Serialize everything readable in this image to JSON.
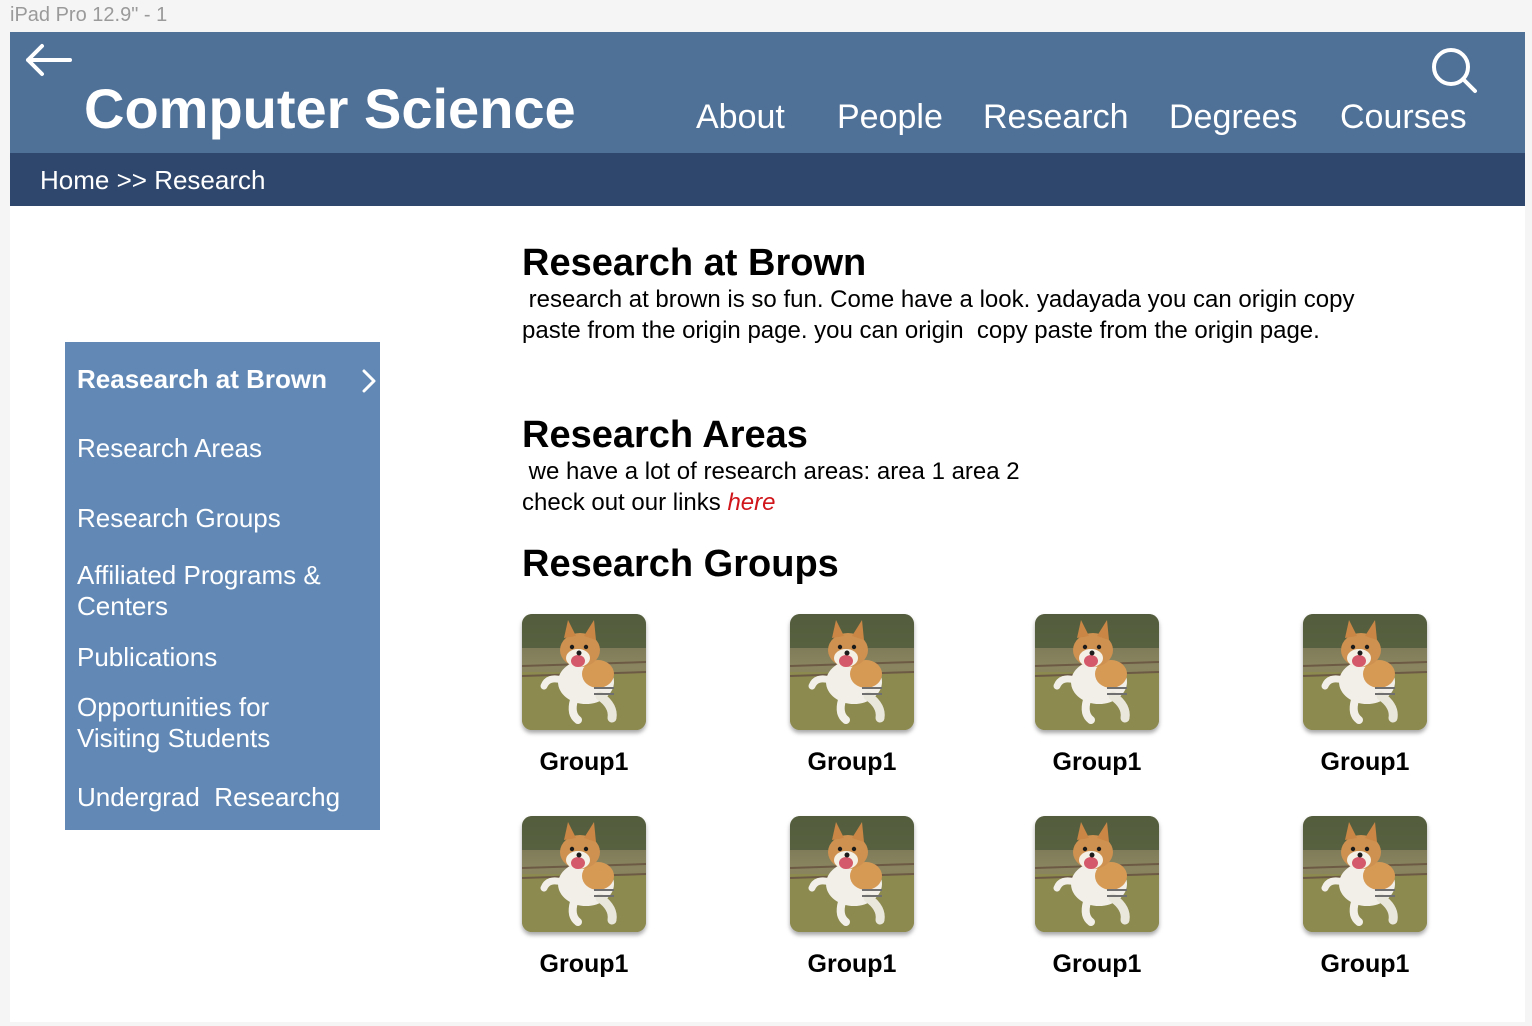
{
  "frame_label": "iPad Pro 12.9\" - 1",
  "header": {
    "title": "Computer Science",
    "nav": [
      "About",
      "People",
      "Research",
      "Degrees",
      "Courses"
    ]
  },
  "breadcrumb": {
    "home": "Home",
    "separator": " >> ",
    "current": "Research"
  },
  "sidebar": {
    "items": [
      "Reasearch at Brown",
      "Research Areas",
      "Research Groups",
      "Affiliated Programs & Centers",
      "Publications",
      "Opportunities for Visiting Students",
      "Undergrad  Researchg"
    ]
  },
  "sections": {
    "brown": {
      "heading": "Research at Brown",
      "body": " research at brown is so fun. Come have a look. yadayada you can origin copy paste from the origin page. you can origin  copy paste from the origin page."
    },
    "areas": {
      "heading": "Research Areas",
      "line1": " we have a lot of research areas: area 1 area 2",
      "line2_prefix": "check out our links ",
      "link_text": "here"
    },
    "groups": {
      "heading": "Research Groups",
      "items": [
        {
          "label": "Group1"
        },
        {
          "label": "Group1"
        },
        {
          "label": "Group1"
        },
        {
          "label": "Group1"
        },
        {
          "label": "Group1"
        },
        {
          "label": "Group1"
        },
        {
          "label": "Group1"
        },
        {
          "label": "Group1"
        }
      ]
    }
  },
  "colors": {
    "header": "#4f7097",
    "breadcrumb_bar": "#2f476c",
    "sidebar": "#6289b6",
    "link": "#d0161b"
  },
  "icons": [
    "back-arrow-icon",
    "search-icon",
    "chevron-right-icon"
  ]
}
